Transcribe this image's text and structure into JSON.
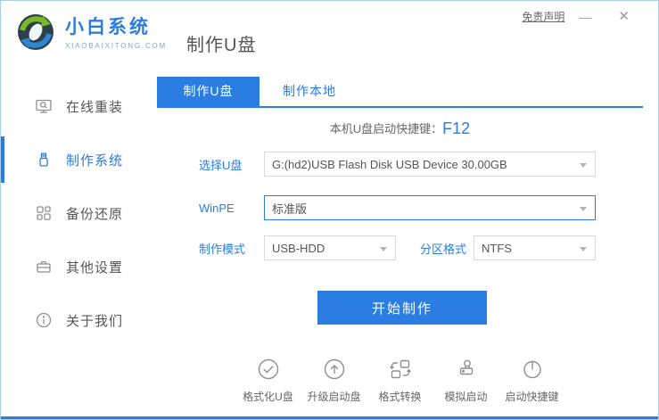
{
  "window": {
    "disclaimer": "免责声明",
    "minimize_glyph": "—",
    "close_glyph": "✕"
  },
  "header": {
    "brand_name": "小白系统",
    "brand_domain": "XIAOBAIXITONG.COM",
    "page_title": "制作U盘"
  },
  "sidebar": {
    "items": [
      {
        "label": "在线重装",
        "icon": "monitor-reinstall-icon",
        "active": false
      },
      {
        "label": "制作系统",
        "icon": "usb-drive-icon",
        "active": true
      },
      {
        "label": "备份还原",
        "icon": "backup-restore-icon",
        "active": false
      },
      {
        "label": "其他设置",
        "icon": "settings-box-icon",
        "active": false
      },
      {
        "label": "关于我们",
        "icon": "info-icon",
        "active": false
      }
    ]
  },
  "main": {
    "tabs": [
      {
        "label": "制作U盘",
        "active": true
      },
      {
        "label": "制作本地",
        "active": false
      }
    ],
    "hotkey": {
      "label": "本机U盘启动快捷键：",
      "value": "F12"
    },
    "form": {
      "usb_select": {
        "label": "选择U盘",
        "value": "G:(hd2)USB Flash Disk USB Device 30.00GB"
      },
      "winpe": {
        "label": "WinPE",
        "value": "标准版"
      },
      "mode": {
        "label": "制作模式",
        "value": "USB-HDD"
      },
      "partition": {
        "label": "分区格式",
        "value": "NTFS"
      }
    },
    "start_button": "开始制作",
    "tools": [
      {
        "label": "格式化U盘",
        "icon": "check-circle-icon"
      },
      {
        "label": "升级启动盘",
        "icon": "arrow-up-circle-icon"
      },
      {
        "label": "格式转换",
        "icon": "convert-icon"
      },
      {
        "label": "模拟启动",
        "icon": "stamp-icon"
      },
      {
        "label": "启动快捷键",
        "icon": "mouse-icon"
      }
    ]
  },
  "colors": {
    "primary_blue": "#2b7de1",
    "text_gray": "#666666",
    "field_border_gray": "#d9d9d9",
    "icon_gray": "#8f8f8f",
    "window_border_blue": "#a9cdf0",
    "logo_green": "#79b928",
    "logo_blue": "#2e86d0",
    "logo_dark": "#2e3f4c"
  }
}
